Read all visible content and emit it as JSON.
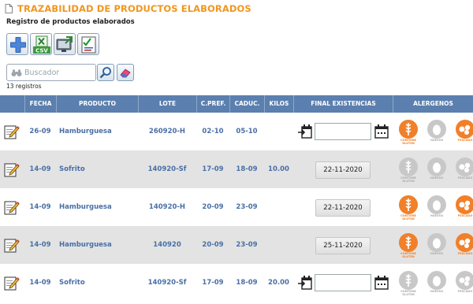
{
  "page": {
    "title": "TRAZABILIDAD DE PRODUCTOS ELABORADOS",
    "subtitle": "Registro de productos elaborados"
  },
  "toolbar": {
    "add_icon": "plus-icon",
    "csv_label": "CSV",
    "csv_icon": "excel-csv-icon",
    "export_icon": "monitor-export-icon",
    "checklist_icon": "checklist-icon"
  },
  "search": {
    "placeholder": "Buscador",
    "value": "",
    "search_icon": "magnifier-icon",
    "clear_icon": "eraser-icon"
  },
  "record_count": "13 registros",
  "columns": [
    "FECHA",
    "PRODUCTO",
    "LOTE",
    "C.PREF.",
    "CADUC.",
    "KILOS",
    "FINAL EXISTENCIAS",
    "ALERGENOS"
  ],
  "allergen_labels": [
    "CONTIENE GLUTEN",
    "HUEVOS",
    "PESCADO"
  ],
  "rows": [
    {
      "fecha": "26-09",
      "producto": "Hamburguesa",
      "lote": "260920-H",
      "cpref": "02-10",
      "caduc": "05-10",
      "kilos": "",
      "final": "",
      "final_editable": true,
      "allergens": [
        true,
        false,
        true
      ]
    },
    {
      "fecha": "14-09",
      "producto": "Sofrito",
      "lote": "140920-Sf",
      "cpref": "17-09",
      "caduc": "18-09",
      "kilos": "10.00",
      "final": "22-11-2020",
      "final_editable": false,
      "allergens": [
        false,
        false,
        false
      ]
    },
    {
      "fecha": "14-09",
      "producto": "Hamburguesa",
      "lote": "140920-H",
      "cpref": "20-09",
      "caduc": "23-09",
      "kilos": "",
      "final": "22-11-2020",
      "final_editable": false,
      "allergens": [
        true,
        false,
        true
      ]
    },
    {
      "fecha": "14-09",
      "producto": "Hamburguesa",
      "lote": "140920",
      "cpref": "20-09",
      "caduc": "23-09",
      "kilos": "",
      "final": "25-11-2020",
      "final_editable": false,
      "allergens": [
        true,
        false,
        true
      ]
    },
    {
      "fecha": "14-09",
      "producto": "Sofrito",
      "lote": "140920-Sf",
      "cpref": "17-09",
      "caduc": "18-09",
      "kilos": "20.00",
      "final": "",
      "final_editable": true,
      "allergens": [
        false,
        false,
        false
      ]
    }
  ],
  "colors": {
    "title": "#f0961e",
    "header_bg": "#5b7fae",
    "link_text": "#4a6fa5",
    "allergen_on": "#f0802a",
    "allergen_off": "#c8c8c8",
    "row_alt": "#e3e3e3"
  }
}
